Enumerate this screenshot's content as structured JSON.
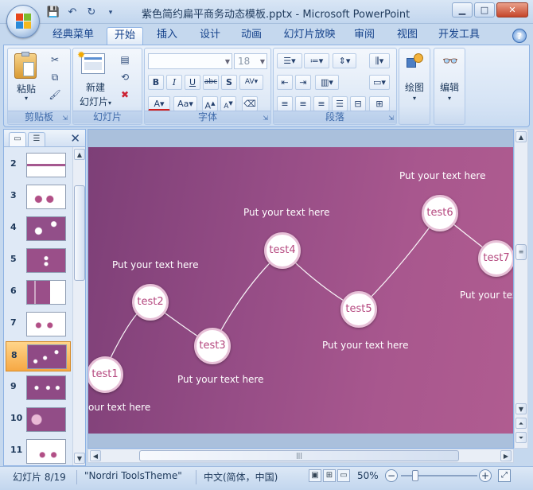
{
  "title_bar": {
    "title": "紫色简约扁平商务动态模板.pptx - Microsoft PowerPoint",
    "qat": [
      "save-icon",
      "undo-icon",
      "redo-icon",
      "customize-icon"
    ],
    "window_buttons": [
      "minimize",
      "maximize",
      "close"
    ]
  },
  "tabs": [
    {
      "label": "经典菜单",
      "active": false
    },
    {
      "label": "开始",
      "active": true
    },
    {
      "label": "插入",
      "active": false
    },
    {
      "label": "设计",
      "active": false
    },
    {
      "label": "动画",
      "active": false
    },
    {
      "label": "幻灯片放映",
      "active": false
    },
    {
      "label": "审阅",
      "active": false
    },
    {
      "label": "视图",
      "active": false
    },
    {
      "label": "开发工具",
      "active": false
    }
  ],
  "ribbon": {
    "clipboard": {
      "label": "剪贴板",
      "paste": "粘贴"
    },
    "slides": {
      "label": "幻灯片",
      "new_slide_line1": "新建",
      "new_slide_line2": "幻灯片"
    },
    "font": {
      "label": "字体",
      "font_size": "18"
    },
    "paragraph": {
      "label": "段落"
    },
    "drawing": {
      "label": "绘图"
    },
    "editing": {
      "label": "编辑"
    }
  },
  "slides_panel": {
    "selected": "8",
    "items": [
      {
        "num": "2"
      },
      {
        "num": "3"
      },
      {
        "num": "4"
      },
      {
        "num": "5"
      },
      {
        "num": "6"
      },
      {
        "num": "7"
      },
      {
        "num": "8"
      },
      {
        "num": "9"
      },
      {
        "num": "10"
      },
      {
        "num": "11"
      }
    ]
  },
  "slide": {
    "nodes": [
      {
        "label": "test1"
      },
      {
        "label": "test2"
      },
      {
        "label": "test3"
      },
      {
        "label": "test4"
      },
      {
        "label": "test5"
      },
      {
        "label": "test6"
      },
      {
        "label": "test7"
      }
    ],
    "texts": {
      "t1": "our text here",
      "t2": "Put your text here",
      "t3": "Put your text here",
      "t4": "Put your text here",
      "t5": "Put your text here",
      "t6": "Put your text here",
      "t7": "Put your text"
    }
  },
  "status_bar": {
    "slide_info": "幻灯片 8/19",
    "theme": "\"Nordri ToolsTheme\"",
    "language": "中文(简体，中国)",
    "zoom": "50%"
  }
}
